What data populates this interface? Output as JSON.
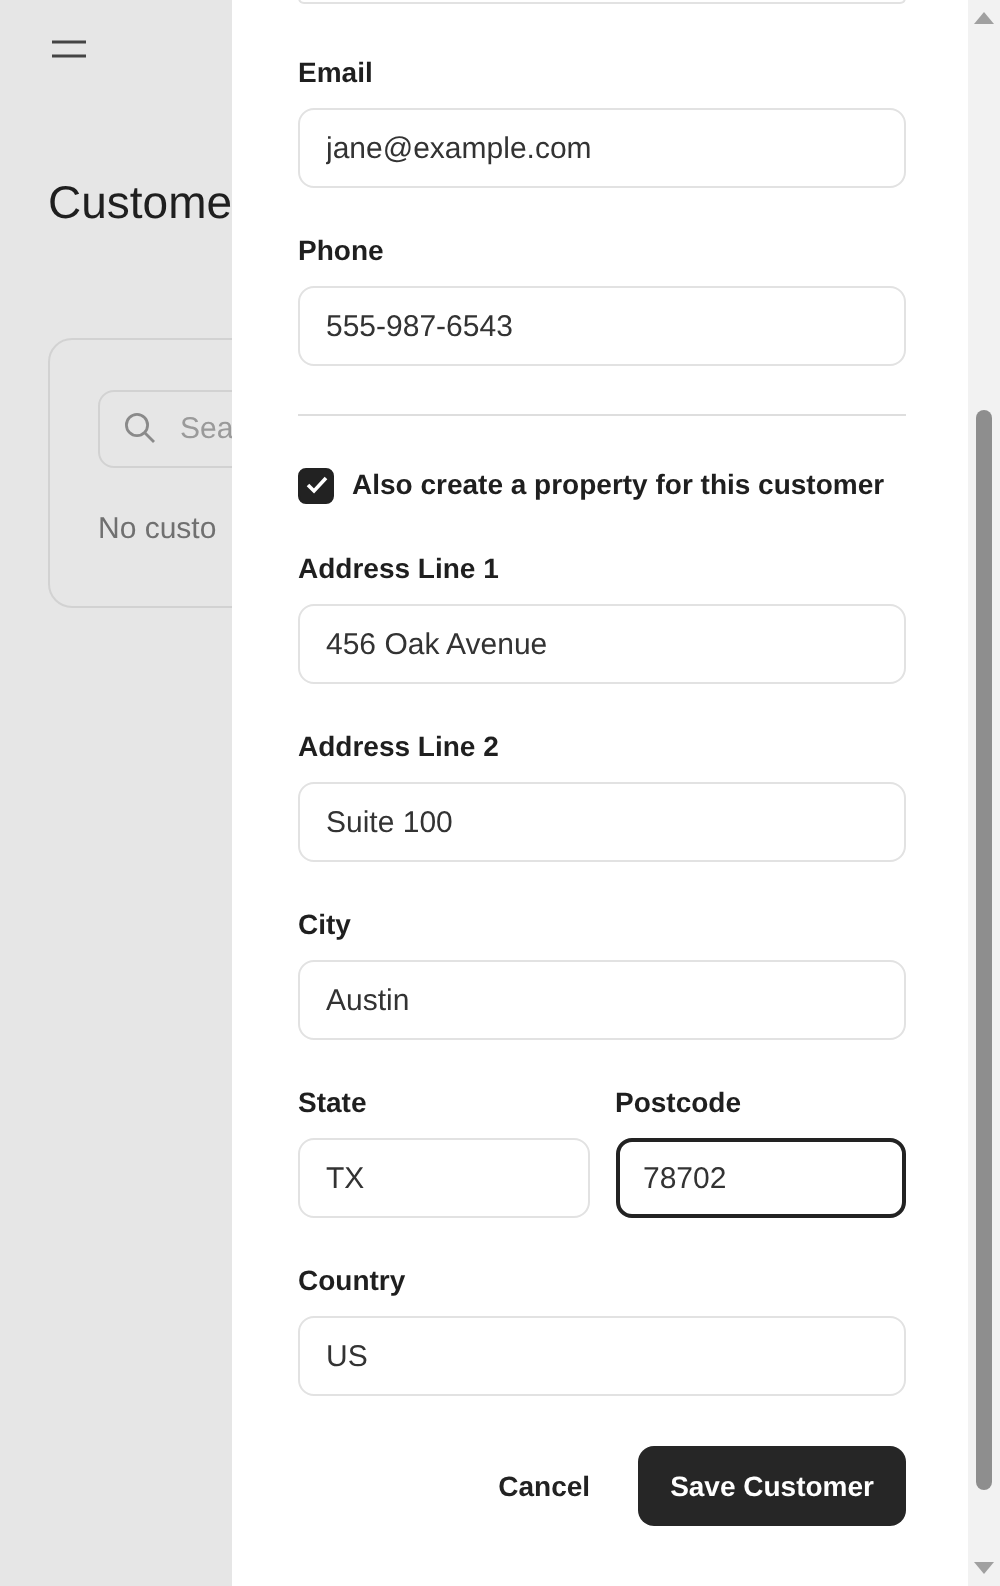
{
  "background_page": {
    "title": "Custome",
    "search": {
      "placeholder": "Sea"
    },
    "empty_text": "No custo"
  },
  "form": {
    "contact_fields": [
      {
        "label": "Email",
        "value": "jane@example.com",
        "focused": false
      },
      {
        "label": "Phone",
        "value": "555-987-6543",
        "focused": false
      }
    ],
    "create_property": {
      "label": "Also create a property for this customer",
      "checked": true
    },
    "address_fields": [
      {
        "label": "Address Line 1",
        "value": "456 Oak Avenue",
        "kind": "full",
        "focused": false
      },
      {
        "label": "Address Line 2",
        "value": "Suite 100",
        "kind": "full",
        "focused": false
      },
      {
        "label": "City",
        "value": "Austin",
        "kind": "full",
        "focused": false
      },
      {
        "label": "State",
        "value": "TX",
        "kind": "half",
        "focused": false
      },
      {
        "label": "Postcode",
        "value": "78702",
        "kind": "half",
        "focused": true
      },
      {
        "label": "Country",
        "value": "US",
        "kind": "full",
        "focused": false
      }
    ],
    "buttons": [
      {
        "label": "Cancel",
        "kind": "link"
      },
      {
        "label": "Save Customer",
        "kind": "primary"
      }
    ]
  }
}
